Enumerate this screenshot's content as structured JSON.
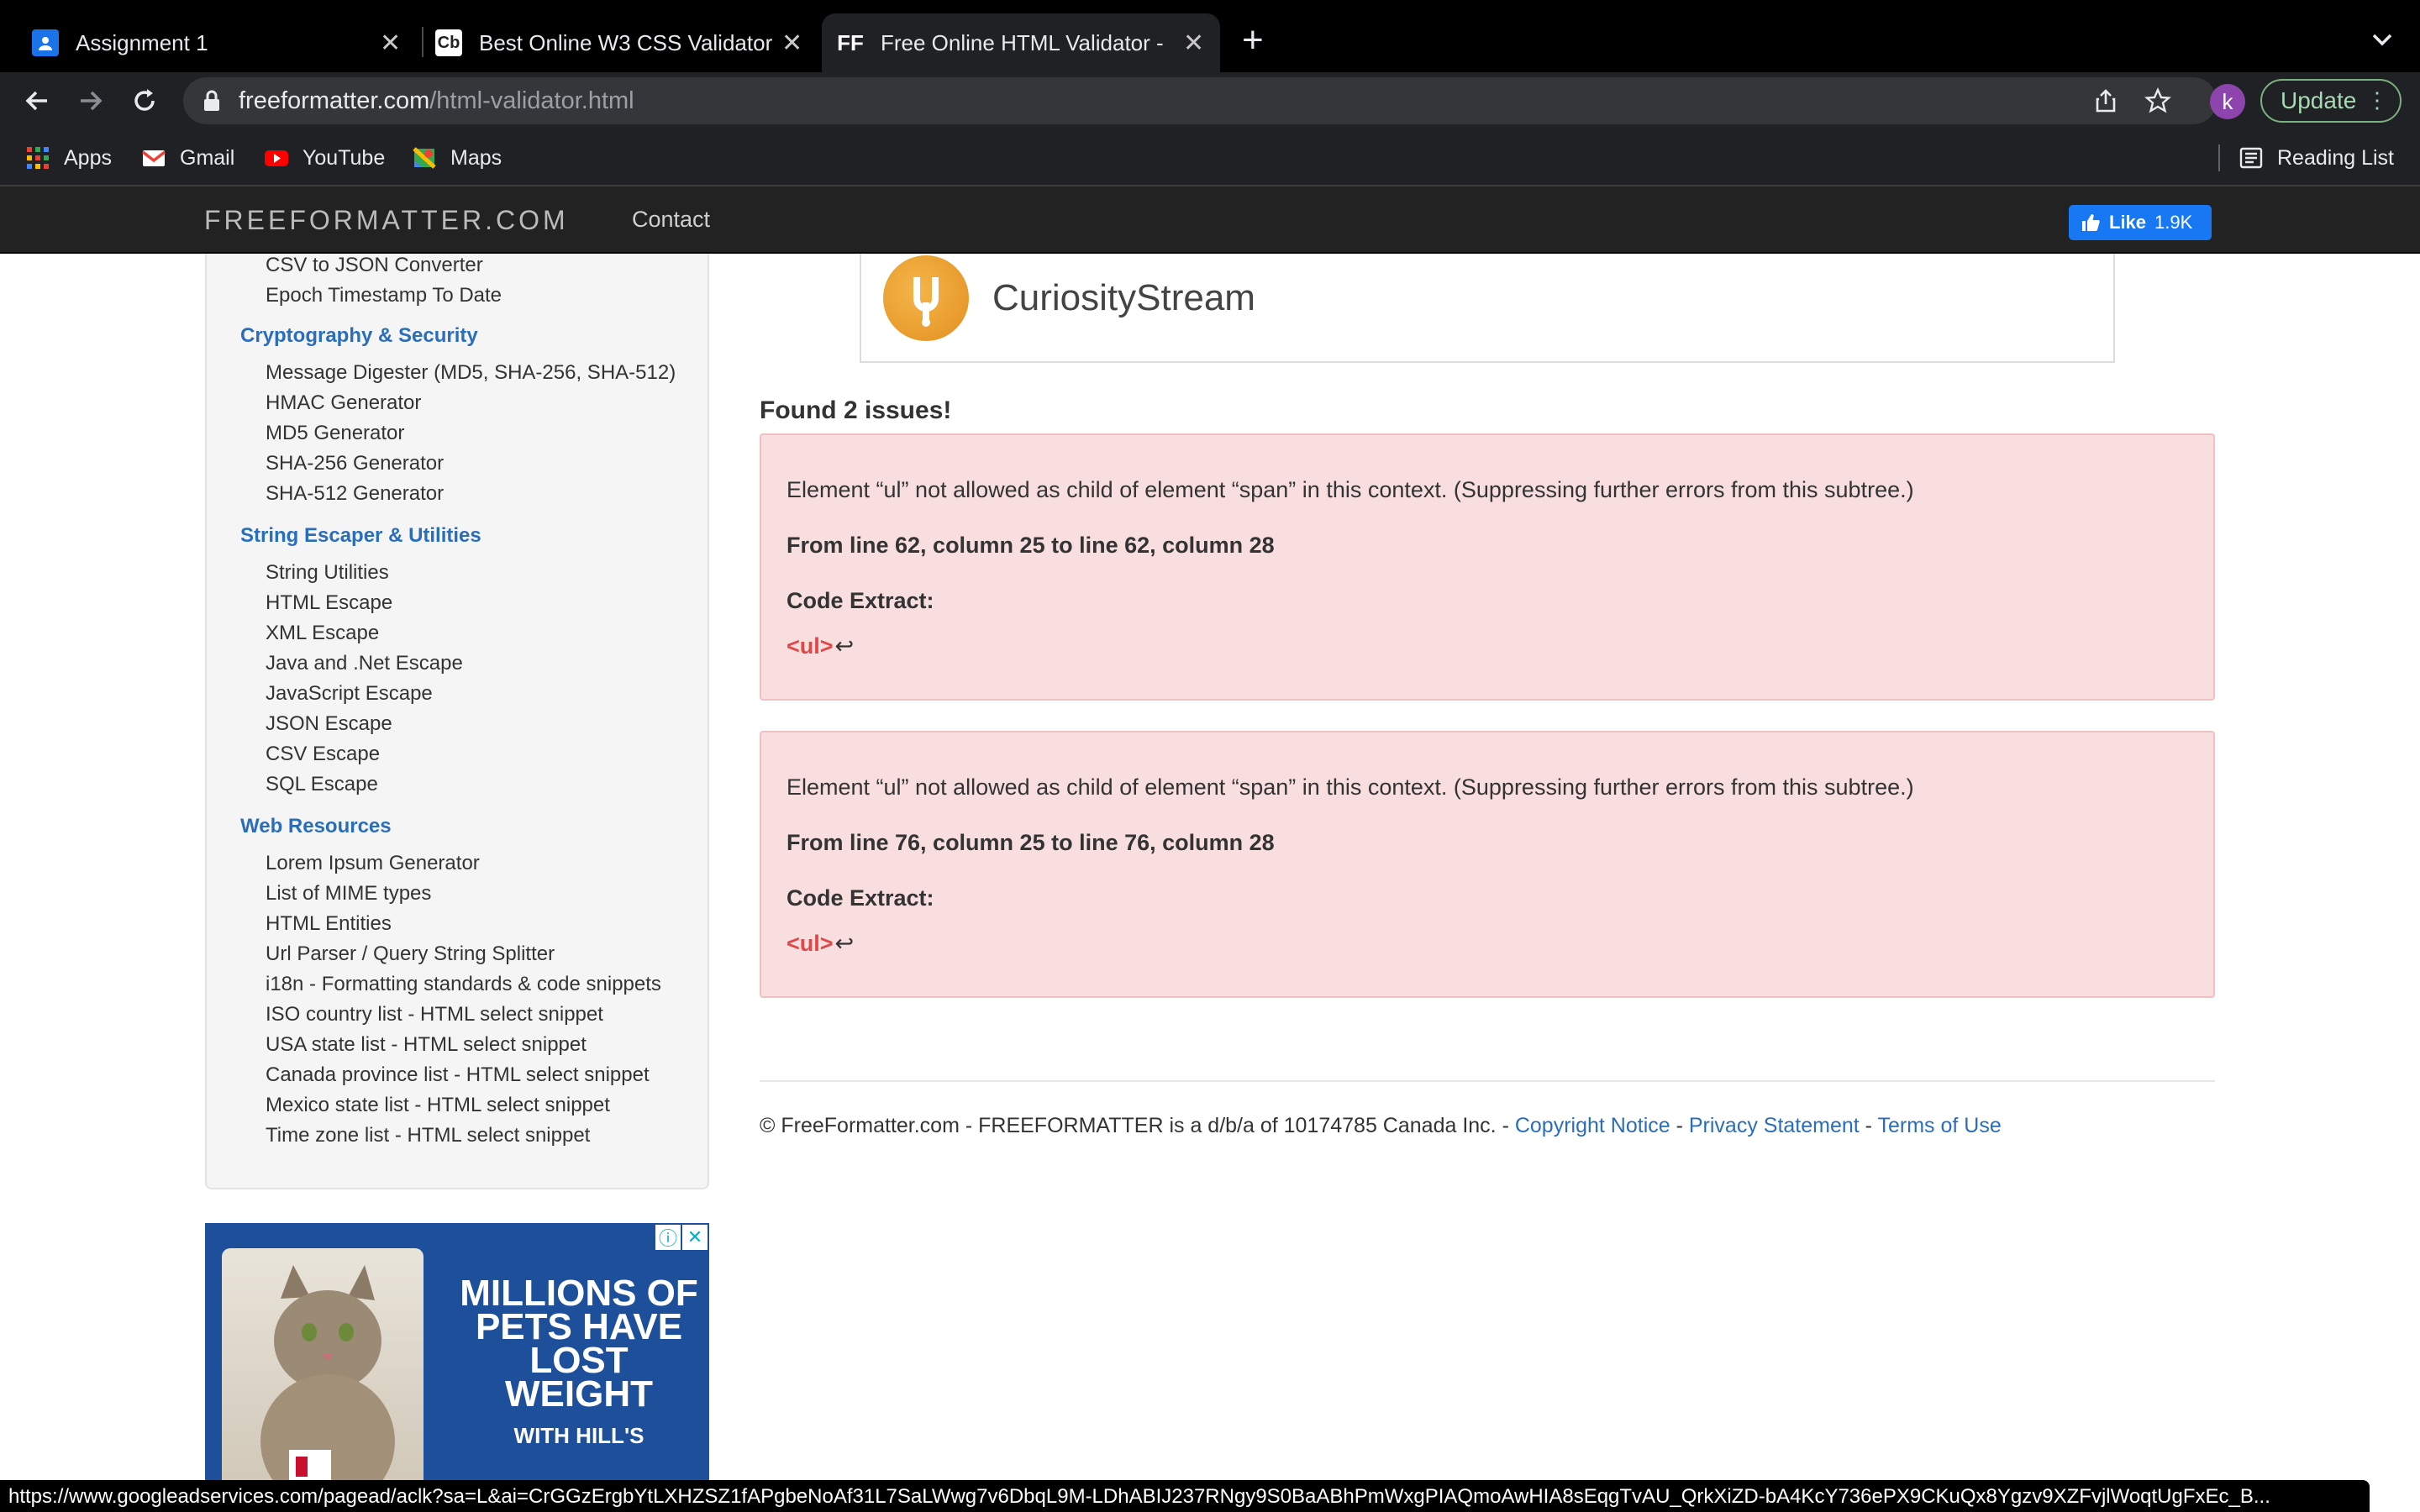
{
  "browser": {
    "tabs": [
      {
        "title": "Assignment 1",
        "favicon": "classroom-icon"
      },
      {
        "title": "Best Online W3 CSS Validator",
        "favicon": "Cb"
      },
      {
        "title": "Free Online HTML Validator - F",
        "favicon": "FF"
      }
    ],
    "url_host": "freeformatter.com",
    "url_path": "/html-validator.html",
    "avatar_letter": "k",
    "update_label": "Update",
    "bookmarks": [
      "Apps",
      "Gmail",
      "YouTube",
      "Maps"
    ],
    "reading_list": "Reading List"
  },
  "site": {
    "brand": "FREEFORMATTER.COM",
    "nav_contact": "Contact",
    "fb_like": "Like",
    "fb_count": "1.9K"
  },
  "sidebar": {
    "top_items": [
      "CSV to JSON Converter",
      "Epoch Timestamp To Date"
    ],
    "sections": [
      {
        "title": "Cryptography & Security",
        "items": [
          "Message Digester (MD5, SHA-256, SHA-512)",
          "HMAC Generator",
          "MD5 Generator",
          "SHA-256 Generator",
          "SHA-512 Generator"
        ]
      },
      {
        "title": "String Escaper & Utilities",
        "items": [
          "String Utilities",
          "HTML Escape",
          "XML Escape",
          "Java and .Net Escape",
          "JavaScript Escape",
          "JSON Escape",
          "CSV Escape",
          "SQL Escape"
        ]
      },
      {
        "title": "Web Resources",
        "items": [
          "Lorem Ipsum Generator",
          "List of MIME types",
          "HTML Entities",
          "Url Parser / Query String Splitter",
          "i18n - Formatting standards & code snippets",
          "ISO country list - HTML select snippet",
          "USA state list - HTML select snippet",
          "Canada province list - HTML select snippet",
          "Mexico state list - HTML select snippet",
          "Time zone list - HTML select snippet"
        ]
      }
    ]
  },
  "ad": {
    "headline": "MILLIONS OF PETS HAVE LOST WEIGHT",
    "sub": "WITH HILL'S"
  },
  "promo": {
    "name": "CuriosityStream"
  },
  "results": {
    "summary": "Found 2 issues!",
    "issues": [
      {
        "message": "Element “ul” not allowed as child of element “span” in this context. (Suppressing further errors from this subtree.)",
        "location": "From line 62, column 25 to line 62, column 28",
        "extract_label": "Code Extract:",
        "code": "<ul>"
      },
      {
        "message": "Element “ul” not allowed as child of element “span” in this context. (Suppressing further errors from this subtree.)",
        "location": "From line 76, column 25 to line 76, column 28",
        "extract_label": "Code Extract:",
        "code": "<ul>"
      }
    ],
    "return_symbol": "↩"
  },
  "footer": {
    "text": "© FreeFormatter.com - FREEFORMATTER is a d/b/a of 10174785 Canada Inc. - ",
    "sep": " - ",
    "copyright": "Copyright Notice",
    "privacy": "Privacy Statement",
    "terms": "Terms of Use"
  },
  "statusbar": "https://www.googleadservices.com/pagead/aclk?sa=L&ai=CrGGzErgbYtLXHZSZ1fAPgbeNoAf31L7SaLWwg7v6DbqL9M-LDhABIJ237RNgy9S0BaABhPmWxgPIAQmoAwHIA8sEqgTvAU_QrkXiZD-bA4KcY736ePX9CKuQx8Ygzv9XZFvjlWoqtUgFxEc_B..."
}
